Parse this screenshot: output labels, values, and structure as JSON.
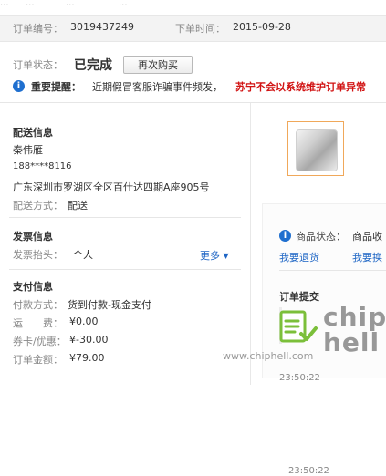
{
  "top_crumbs": [
    "...",
    "...",
    "...",
    "..."
  ],
  "order": {
    "number_label": "订单编号：",
    "number_value": "3019437249",
    "time_label": "下单时间：",
    "time_value": "2015-09-28"
  },
  "status": {
    "label": "订单状态：",
    "value": "已完成",
    "rebuy_button": "再次购买"
  },
  "notice": {
    "title": "重要提醒：",
    "text": "近期假冒客服诈骗事件频发，",
    "emphasis": "苏宁不会以系统维护订单异常"
  },
  "shipping": {
    "title": "配送信息",
    "name": "秦伟雁",
    "phone": "188****8116",
    "address": "广东深圳市罗湖区全区百仕达四期A座905号",
    "method_label": "配送方式：",
    "method_value": "配送"
  },
  "invoice": {
    "title": "发票信息",
    "header_label": "发票抬头：",
    "header_value": "个人",
    "more_link": "更多"
  },
  "payment": {
    "title": "支付信息",
    "method_label": "付款方式：",
    "method_value": "货到付款-现金支付",
    "shipping_fee_label": "运　　费：",
    "shipping_fee_value": "¥0.00",
    "coupon_label": "券卡/优惠：",
    "coupon_value": "¥-30.00",
    "total_label": "订单金额：",
    "total_value": "¥79.00"
  },
  "right_panel": {
    "goods_status_label": "商品状态：",
    "goods_status_value": "商品收",
    "return_link": "我要退货",
    "exchange_link": "我要换",
    "timeline_title": "订单提交",
    "timeline_time": "23:50:22"
  },
  "watermark": {
    "site": "www.chiphell.com",
    "logo_text": "chip hell"
  },
  "colors": {
    "accent_blue": "#1f66c5",
    "alert_red": "#d11212",
    "thumb_border": "#f0a85a",
    "watermark_green": "#7bbf3a"
  }
}
